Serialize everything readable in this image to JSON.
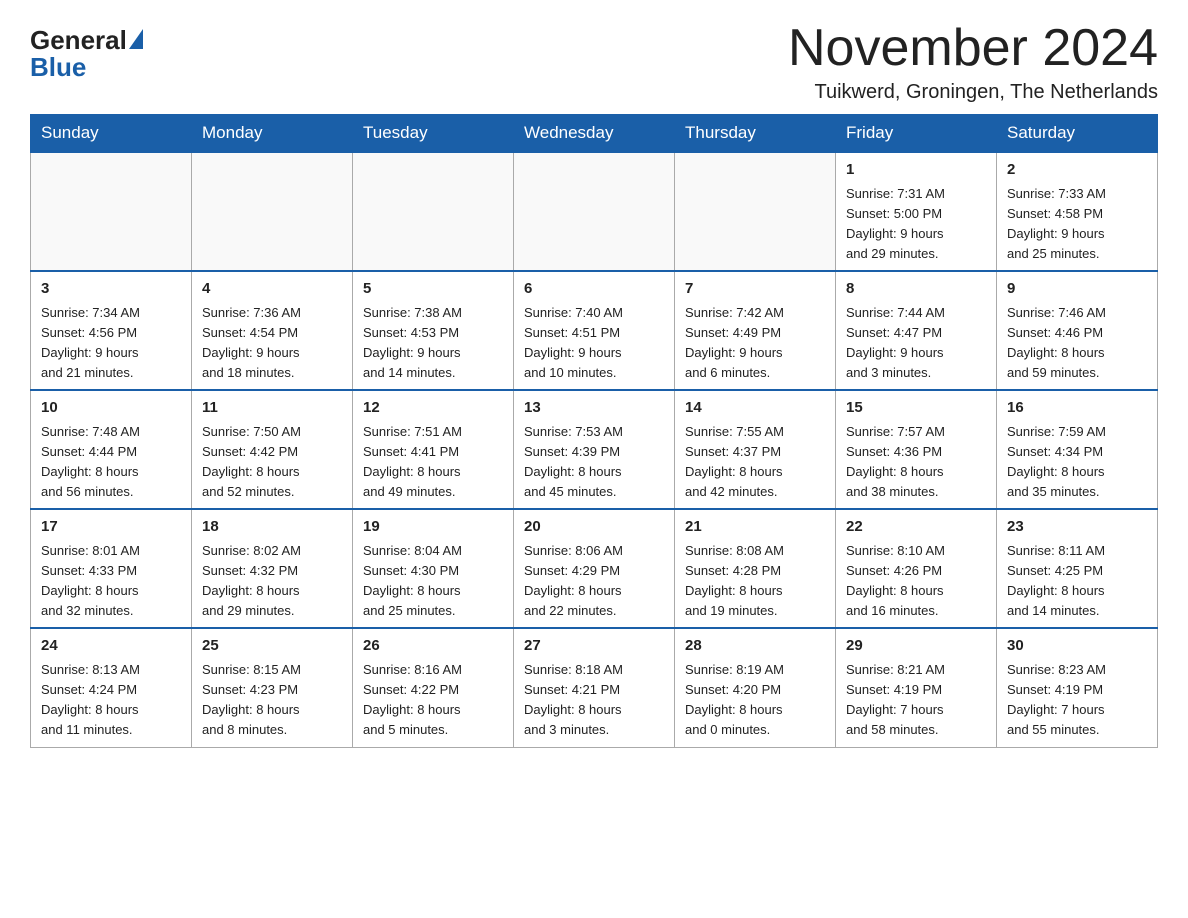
{
  "header": {
    "logo_general": "General",
    "logo_blue": "Blue",
    "month_year": "November 2024",
    "location": "Tuikwerd, Groningen, The Netherlands"
  },
  "days_of_week": [
    "Sunday",
    "Monday",
    "Tuesday",
    "Wednesday",
    "Thursday",
    "Friday",
    "Saturday"
  ],
  "weeks": [
    [
      {
        "day": "",
        "info": ""
      },
      {
        "day": "",
        "info": ""
      },
      {
        "day": "",
        "info": ""
      },
      {
        "day": "",
        "info": ""
      },
      {
        "day": "",
        "info": ""
      },
      {
        "day": "1",
        "info": "Sunrise: 7:31 AM\nSunset: 5:00 PM\nDaylight: 9 hours\nand 29 minutes."
      },
      {
        "day": "2",
        "info": "Sunrise: 7:33 AM\nSunset: 4:58 PM\nDaylight: 9 hours\nand 25 minutes."
      }
    ],
    [
      {
        "day": "3",
        "info": "Sunrise: 7:34 AM\nSunset: 4:56 PM\nDaylight: 9 hours\nand 21 minutes."
      },
      {
        "day": "4",
        "info": "Sunrise: 7:36 AM\nSunset: 4:54 PM\nDaylight: 9 hours\nand 18 minutes."
      },
      {
        "day": "5",
        "info": "Sunrise: 7:38 AM\nSunset: 4:53 PM\nDaylight: 9 hours\nand 14 minutes."
      },
      {
        "day": "6",
        "info": "Sunrise: 7:40 AM\nSunset: 4:51 PM\nDaylight: 9 hours\nand 10 minutes."
      },
      {
        "day": "7",
        "info": "Sunrise: 7:42 AM\nSunset: 4:49 PM\nDaylight: 9 hours\nand 6 minutes."
      },
      {
        "day": "8",
        "info": "Sunrise: 7:44 AM\nSunset: 4:47 PM\nDaylight: 9 hours\nand 3 minutes."
      },
      {
        "day": "9",
        "info": "Sunrise: 7:46 AM\nSunset: 4:46 PM\nDaylight: 8 hours\nand 59 minutes."
      }
    ],
    [
      {
        "day": "10",
        "info": "Sunrise: 7:48 AM\nSunset: 4:44 PM\nDaylight: 8 hours\nand 56 minutes."
      },
      {
        "day": "11",
        "info": "Sunrise: 7:50 AM\nSunset: 4:42 PM\nDaylight: 8 hours\nand 52 minutes."
      },
      {
        "day": "12",
        "info": "Sunrise: 7:51 AM\nSunset: 4:41 PM\nDaylight: 8 hours\nand 49 minutes."
      },
      {
        "day": "13",
        "info": "Sunrise: 7:53 AM\nSunset: 4:39 PM\nDaylight: 8 hours\nand 45 minutes."
      },
      {
        "day": "14",
        "info": "Sunrise: 7:55 AM\nSunset: 4:37 PM\nDaylight: 8 hours\nand 42 minutes."
      },
      {
        "day": "15",
        "info": "Sunrise: 7:57 AM\nSunset: 4:36 PM\nDaylight: 8 hours\nand 38 minutes."
      },
      {
        "day": "16",
        "info": "Sunrise: 7:59 AM\nSunset: 4:34 PM\nDaylight: 8 hours\nand 35 minutes."
      }
    ],
    [
      {
        "day": "17",
        "info": "Sunrise: 8:01 AM\nSunset: 4:33 PM\nDaylight: 8 hours\nand 32 minutes."
      },
      {
        "day": "18",
        "info": "Sunrise: 8:02 AM\nSunset: 4:32 PM\nDaylight: 8 hours\nand 29 minutes."
      },
      {
        "day": "19",
        "info": "Sunrise: 8:04 AM\nSunset: 4:30 PM\nDaylight: 8 hours\nand 25 minutes."
      },
      {
        "day": "20",
        "info": "Sunrise: 8:06 AM\nSunset: 4:29 PM\nDaylight: 8 hours\nand 22 minutes."
      },
      {
        "day": "21",
        "info": "Sunrise: 8:08 AM\nSunset: 4:28 PM\nDaylight: 8 hours\nand 19 minutes."
      },
      {
        "day": "22",
        "info": "Sunrise: 8:10 AM\nSunset: 4:26 PM\nDaylight: 8 hours\nand 16 minutes."
      },
      {
        "day": "23",
        "info": "Sunrise: 8:11 AM\nSunset: 4:25 PM\nDaylight: 8 hours\nand 14 minutes."
      }
    ],
    [
      {
        "day": "24",
        "info": "Sunrise: 8:13 AM\nSunset: 4:24 PM\nDaylight: 8 hours\nand 11 minutes."
      },
      {
        "day": "25",
        "info": "Sunrise: 8:15 AM\nSunset: 4:23 PM\nDaylight: 8 hours\nand 8 minutes."
      },
      {
        "day": "26",
        "info": "Sunrise: 8:16 AM\nSunset: 4:22 PM\nDaylight: 8 hours\nand 5 minutes."
      },
      {
        "day": "27",
        "info": "Sunrise: 8:18 AM\nSunset: 4:21 PM\nDaylight: 8 hours\nand 3 minutes."
      },
      {
        "day": "28",
        "info": "Sunrise: 8:19 AM\nSunset: 4:20 PM\nDaylight: 8 hours\nand 0 minutes."
      },
      {
        "day": "29",
        "info": "Sunrise: 8:21 AM\nSunset: 4:19 PM\nDaylight: 7 hours\nand 58 minutes."
      },
      {
        "day": "30",
        "info": "Sunrise: 8:23 AM\nSunset: 4:19 PM\nDaylight: 7 hours\nand 55 minutes."
      }
    ]
  ]
}
